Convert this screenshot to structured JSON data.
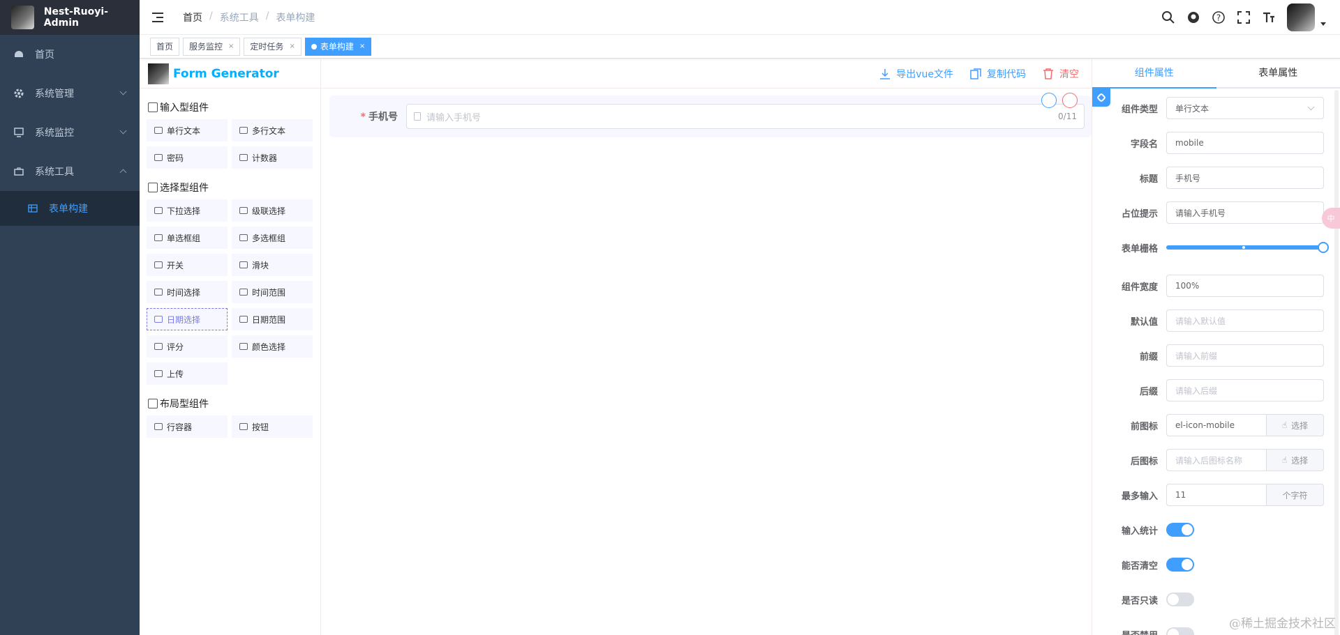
{
  "brand": {
    "name": "Nest-Ruoyi-Admin"
  },
  "sidebar": {
    "items": [
      {
        "label": "首页"
      },
      {
        "label": "系统管理"
      },
      {
        "label": "系统监控"
      },
      {
        "label": "系统工具"
      }
    ],
    "submenu": [
      {
        "label": "表单构建"
      }
    ]
  },
  "breadcrumb": {
    "home": "首页",
    "sep": "/",
    "level2": "系统工具",
    "current": "表单构建"
  },
  "tags": [
    {
      "label": "首页"
    },
    {
      "label": "服务监控"
    },
    {
      "label": "定时任务"
    },
    {
      "label": "表单构建"
    }
  ],
  "tag_close": "×",
  "generator": {
    "title": "Form Generator",
    "actions": {
      "export": "导出vue文件",
      "copy": "复制代码",
      "clear": "清空"
    }
  },
  "components": {
    "input_title": "输入型组件",
    "input": [
      "单行文本",
      "多行文本",
      "密码",
      "计数器"
    ],
    "select_title": "选择型组件",
    "select": [
      "下拉选择",
      "级联选择",
      "单选框组",
      "多选框组",
      "开关",
      "滑块",
      "时间选择",
      "时间范围",
      "日期选择",
      "日期范围",
      "评分",
      "颜色选择",
      "上传"
    ],
    "layout_title": "布局型组件",
    "layout": [
      "行容器",
      "按钮"
    ]
  },
  "canvas": {
    "field": {
      "label": "手机号",
      "placeholder": "请输入手机号",
      "counter": "0/11"
    }
  },
  "right_panel": {
    "tabs": [
      "组件属性",
      "表单属性"
    ],
    "props": {
      "type_label": "组件类型",
      "type_value": "单行文本",
      "field_label": "字段名",
      "field_value": "mobile",
      "title_label": "标题",
      "title_value": "手机号",
      "placeholder_label": "占位提示",
      "placeholder_value": "请输入手机号",
      "span_label": "表单栅格",
      "span_value": 24,
      "span_max": 24,
      "width_label": "组件宽度",
      "width_value": "100%",
      "default_label": "默认值",
      "default_placeholder": "请输入默认值",
      "prefix_label": "前缀",
      "prefix_placeholder": "请输入前缀",
      "suffix_label": "后缀",
      "suffix_placeholder": "请输入后缀",
      "prefix_icon_label": "前图标",
      "prefix_icon_value": "el-icon-mobile",
      "select_btn": "选择",
      "suffix_icon_label": "后图标",
      "suffix_icon_placeholder": "请输入后图标名称",
      "maxlength_label": "最多输入",
      "maxlength_value": "11",
      "maxlength_unit": "个字符",
      "show_word_limit_label": "输入统计",
      "show_word_limit": true,
      "clearable_label": "能否清空",
      "clearable": true,
      "readonly_label": "是否只读",
      "readonly": false,
      "disabled_label": "是否禁用",
      "disabled": false
    }
  },
  "watermark": "@稀土掘金技术社区",
  "float_badge": "中"
}
